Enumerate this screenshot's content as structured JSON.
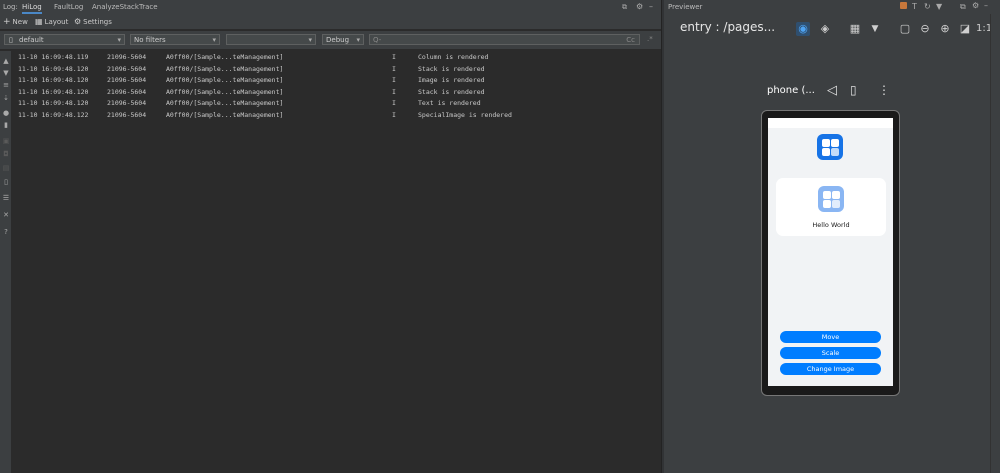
{
  "log": {
    "tabs": [
      "Log:",
      "HiLog",
      "FaultLog",
      "AnalyzeStackTrace"
    ],
    "toolbar": {
      "new_label": "New",
      "layout_label": "Layout",
      "settings_label": "Settings"
    },
    "filters": {
      "device_value": "default",
      "filter_value": "No filters",
      "process_value": "",
      "level_value": "Debug",
      "search_placeholder": "Q-",
      "case_label": "Cc",
      "regex_label": ".*"
    },
    "rows": [
      {
        "time": "11-10 16:09:48.119",
        "pid": "21096-5604",
        "tag": "A0ff00/[Sample...teManagement]",
        "level": "I",
        "msg": "Column is rendered"
      },
      {
        "time": "11-10 16:09:48.120",
        "pid": "21096-5604",
        "tag": "A0ff00/[Sample...teManagement]",
        "level": "I",
        "msg": "Stack is rendered"
      },
      {
        "time": "11-10 16:09:48.120",
        "pid": "21096-5604",
        "tag": "A0ff00/[Sample...teManagement]",
        "level": "I",
        "msg": "Image is rendered"
      },
      {
        "time": "11-10 16:09:48.120",
        "pid": "21096-5604",
        "tag": "A0ff00/[Sample...teManagement]",
        "level": "I",
        "msg": "Stack is rendered"
      },
      {
        "time": "11-10 16:09:48.120",
        "pid": "21096-5604",
        "tag": "A0ff00/[Sample...teManagement]",
        "level": "I",
        "msg": "Text is rendered"
      },
      {
        "time": "11-10 16:09:48.122",
        "pid": "21096-5604",
        "tag": "A0ff00/[Sample...teManagement]",
        "level": "I",
        "msg": "SpecialImage is rendered"
      }
    ]
  },
  "previewer": {
    "title": "Previewer",
    "page_label": "entry : /pages...",
    "zoom_label": "1:1",
    "device_label": "phone (...",
    "app": {
      "card_text": "Hello World",
      "buttons": [
        "Move",
        "Scale",
        "Change Image"
      ]
    }
  },
  "colors": {
    "accent": "#007dff",
    "icon_blue": "#1773e6"
  }
}
